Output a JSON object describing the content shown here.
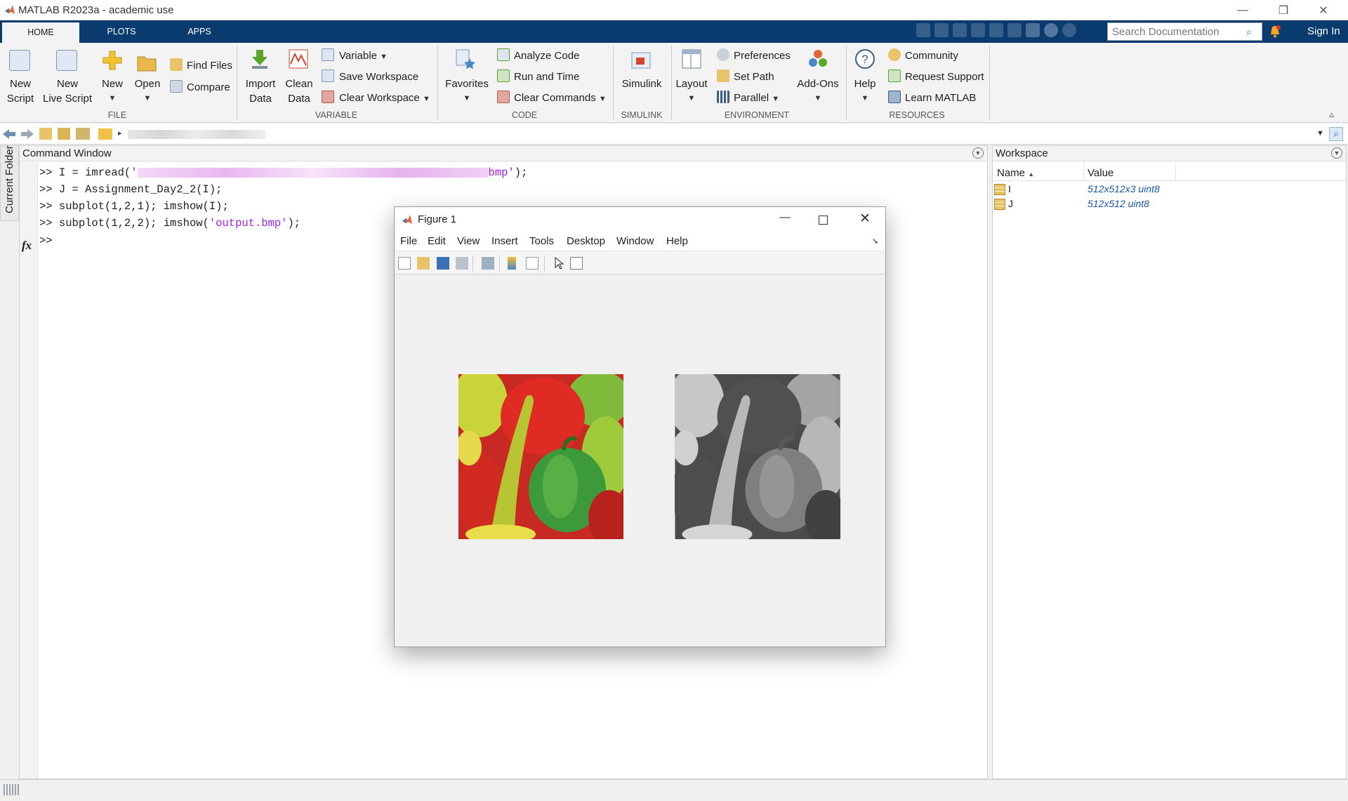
{
  "window": {
    "title": "MATLAB R2023a - academic use"
  },
  "tabs": [
    {
      "label": "HOME"
    },
    {
      "label": "PLOTS"
    },
    {
      "label": "APPS"
    }
  ],
  "search": {
    "placeholder": "Search Documentation"
  },
  "signin": "Sign In",
  "ribbon": {
    "file": {
      "new_script": [
        "New",
        "Script"
      ],
      "new_live_script": [
        "New",
        "Live Script"
      ],
      "new": "New",
      "open": "Open",
      "find_files": "Find Files",
      "compare": "Compare",
      "group": "FILE"
    },
    "variable": {
      "import_data": [
        "Import",
        "Data"
      ],
      "clean_data": [
        "Clean",
        "Data"
      ],
      "variable": "Variable",
      "save_workspace": "Save Workspace",
      "clear_workspace": "Clear Workspace",
      "group": "VARIABLE"
    },
    "code": {
      "favorites": "Favorites",
      "analyze_code": "Analyze Code",
      "run_and_time": "Run and Time",
      "clear_commands": "Clear Commands",
      "group": "CODE"
    },
    "simulink": {
      "simulink": "Simulink",
      "group": "SIMULINK"
    },
    "environment": {
      "layout": "Layout",
      "preferences": "Preferences",
      "set_path": "Set Path",
      "parallel": "Parallel",
      "add_ons": "Add-Ons",
      "group": "ENVIRONMENT"
    },
    "resources": {
      "help": "Help",
      "community": "Community",
      "request_support": "Request Support",
      "learn_matlab": "Learn MATLAB",
      "group": "RESOURCES"
    }
  },
  "sidebar": {
    "current_folder": "Current Folder"
  },
  "command_window": {
    "title": "Command Window",
    "lines": [
      {
        "prompt": ">>",
        "before": " I = imread(",
        "str_open": "'",
        "str_end": "bmp'",
        "after": ");"
      },
      {
        "prompt": ">>",
        "text": " J = Assignment_Day2_2(I);"
      },
      {
        "prompt": ">>",
        "text": " subplot(1,2,1); imshow(I);"
      },
      {
        "prompt": ">>",
        "before": " subplot(1,2,2); imshow(",
        "str": "'output.bmp'",
        "after": ");"
      }
    ],
    "fx": "fx",
    "prompt": ">>"
  },
  "workspace": {
    "title": "Workspace",
    "columns": [
      "Name",
      "Value"
    ],
    "rows": [
      {
        "name": "I",
        "value": "512x512x3 uint8"
      },
      {
        "name": "J",
        "value": "512x512 uint8"
      }
    ]
  },
  "figure": {
    "title": "Figure 1",
    "menu": [
      "File",
      "Edit",
      "View",
      "Insert",
      "Tools",
      "Desktop",
      "Window",
      "Help"
    ]
  },
  "colors": {
    "tab_strip": "#0a3b6e",
    "string_literal": "#a020f0",
    "workspace_value": "#1a56a8"
  }
}
